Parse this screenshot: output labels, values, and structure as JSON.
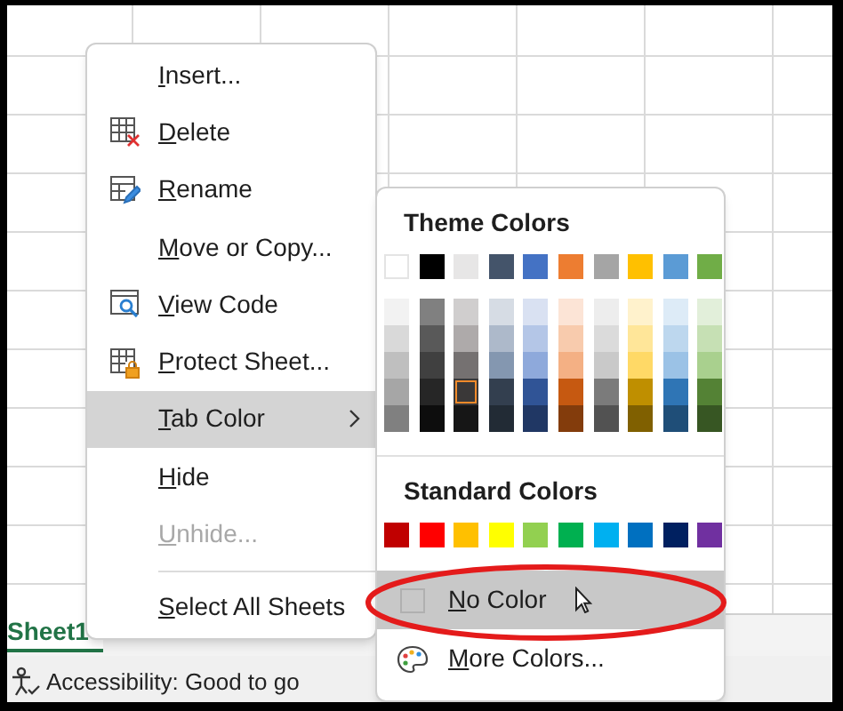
{
  "context_menu": {
    "items": [
      {
        "label": "Insert...",
        "highlighted": false,
        "disabled": false,
        "submenu": false
      },
      {
        "label": "Delete",
        "highlighted": false,
        "disabled": false,
        "submenu": false
      },
      {
        "label": "Rename",
        "highlighted": false,
        "disabled": false,
        "submenu": false
      },
      {
        "label": "Move or Copy...",
        "highlighted": false,
        "disabled": false,
        "submenu": false
      },
      {
        "label": "View Code",
        "highlighted": false,
        "disabled": false,
        "submenu": false
      },
      {
        "label": "Protect Sheet...",
        "highlighted": false,
        "disabled": false,
        "submenu": false
      },
      {
        "label": "Tab Color",
        "highlighted": true,
        "disabled": false,
        "submenu": true
      },
      {
        "label": "Hide",
        "highlighted": false,
        "disabled": false,
        "submenu": false
      },
      {
        "label": "Unhide...",
        "highlighted": false,
        "disabled": true,
        "submenu": false,
        "separator_after": true
      },
      {
        "label": "Select All Sheets",
        "highlighted": false,
        "disabled": false,
        "submenu": false
      }
    ]
  },
  "tab_color_menu": {
    "theme_title": "Theme Colors",
    "theme_colors": [
      {
        "color": "#ffffff",
        "selected": false,
        "shades": [
          {
            "color": "#f2f2f2",
            "selected": false
          },
          {
            "color": "#d9d9d9",
            "selected": false
          },
          {
            "color": "#bfbfbf",
            "selected": false
          },
          {
            "color": "#a6a6a6",
            "selected": false
          },
          {
            "color": "#808080",
            "selected": false
          }
        ]
      },
      {
        "color": "#000000",
        "selected": false,
        "shades": [
          {
            "color": "#808080",
            "selected": false
          },
          {
            "color": "#595959",
            "selected": false
          },
          {
            "color": "#404040",
            "selected": false
          },
          {
            "color": "#262626",
            "selected": false
          },
          {
            "color": "#0d0d0d",
            "selected": false
          }
        ]
      },
      {
        "color": "#e7e6e6",
        "selected": false,
        "shades": [
          {
            "color": "#d0cece",
            "selected": false
          },
          {
            "color": "#aeaaaa",
            "selected": false
          },
          {
            "color": "#757171",
            "selected": false
          },
          {
            "color": "#3a3838",
            "selected": true
          },
          {
            "color": "#161616",
            "selected": false
          }
        ]
      },
      {
        "color": "#44546a",
        "selected": false,
        "shades": [
          {
            "color": "#d6dce4",
            "selected": false
          },
          {
            "color": "#adb9ca",
            "selected": false
          },
          {
            "color": "#8497b0",
            "selected": false
          },
          {
            "color": "#333f4f",
            "selected": false
          },
          {
            "color": "#222b35",
            "selected": false
          }
        ]
      },
      {
        "color": "#4472c4",
        "selected": false,
        "shades": [
          {
            "color": "#d9e1f2",
            "selected": false
          },
          {
            "color": "#b4c6e7",
            "selected": false
          },
          {
            "color": "#8ea9db",
            "selected": false
          },
          {
            "color": "#305496",
            "selected": false
          },
          {
            "color": "#203764",
            "selected": false
          }
        ]
      },
      {
        "color": "#ed7d31",
        "selected": false,
        "shades": [
          {
            "color": "#fce4d6",
            "selected": false
          },
          {
            "color": "#f8cbad",
            "selected": false
          },
          {
            "color": "#f4b084",
            "selected": false
          },
          {
            "color": "#c65911",
            "selected": false
          },
          {
            "color": "#833c0c",
            "selected": false
          }
        ]
      },
      {
        "color": "#a5a5a5",
        "selected": false,
        "shades": [
          {
            "color": "#ededed",
            "selected": false
          },
          {
            "color": "#dbdbdb",
            "selected": false
          },
          {
            "color": "#c9c9c9",
            "selected": false
          },
          {
            "color": "#7b7b7b",
            "selected": false
          },
          {
            "color": "#525252",
            "selected": false
          }
        ]
      },
      {
        "color": "#ffc000",
        "selected": false,
        "shades": [
          {
            "color": "#fff2cc",
            "selected": false
          },
          {
            "color": "#ffe699",
            "selected": false
          },
          {
            "color": "#ffd966",
            "selected": false
          },
          {
            "color": "#bf8f00",
            "selected": false
          },
          {
            "color": "#806000",
            "selected": false
          }
        ]
      },
      {
        "color": "#5b9bd5",
        "selected": false,
        "shades": [
          {
            "color": "#ddebf7",
            "selected": false
          },
          {
            "color": "#bdd7ee",
            "selected": false
          },
          {
            "color": "#9bc2e6",
            "selected": false
          },
          {
            "color": "#2f75b5",
            "selected": false
          },
          {
            "color": "#1f4e78",
            "selected": false
          }
        ]
      },
      {
        "color": "#70ad47",
        "selected": false,
        "shades": [
          {
            "color": "#e2efda",
            "selected": false
          },
          {
            "color": "#c6e0b4",
            "selected": false
          },
          {
            "color": "#a9d08e",
            "selected": false
          },
          {
            "color": "#548235",
            "selected": false
          },
          {
            "color": "#375623",
            "selected": false
          }
        ]
      }
    ],
    "standard_title": "Standard Colors",
    "standard_colors": [
      {
        "color": "#c00000",
        "selected": false
      },
      {
        "color": "#ff0000",
        "selected": false
      },
      {
        "color": "#ffc000",
        "selected": false
      },
      {
        "color": "#ffff00",
        "selected": false
      },
      {
        "color": "#92d050",
        "selected": false
      },
      {
        "color": "#00b050",
        "selected": false
      },
      {
        "color": "#00b0f0",
        "selected": false
      },
      {
        "color": "#0070c0",
        "selected": false
      },
      {
        "color": "#002060",
        "selected": false
      },
      {
        "color": "#7030a0",
        "selected": false
      }
    ],
    "no_color": {
      "label": "No Color",
      "highlighted": true
    },
    "more_colors": {
      "label": "More Colors...",
      "highlighted": false
    }
  },
  "sheet_tab": {
    "label": "Sheet1",
    "selected": true
  },
  "status_bar": {
    "text": "Accessibility: Good to go"
  }
}
